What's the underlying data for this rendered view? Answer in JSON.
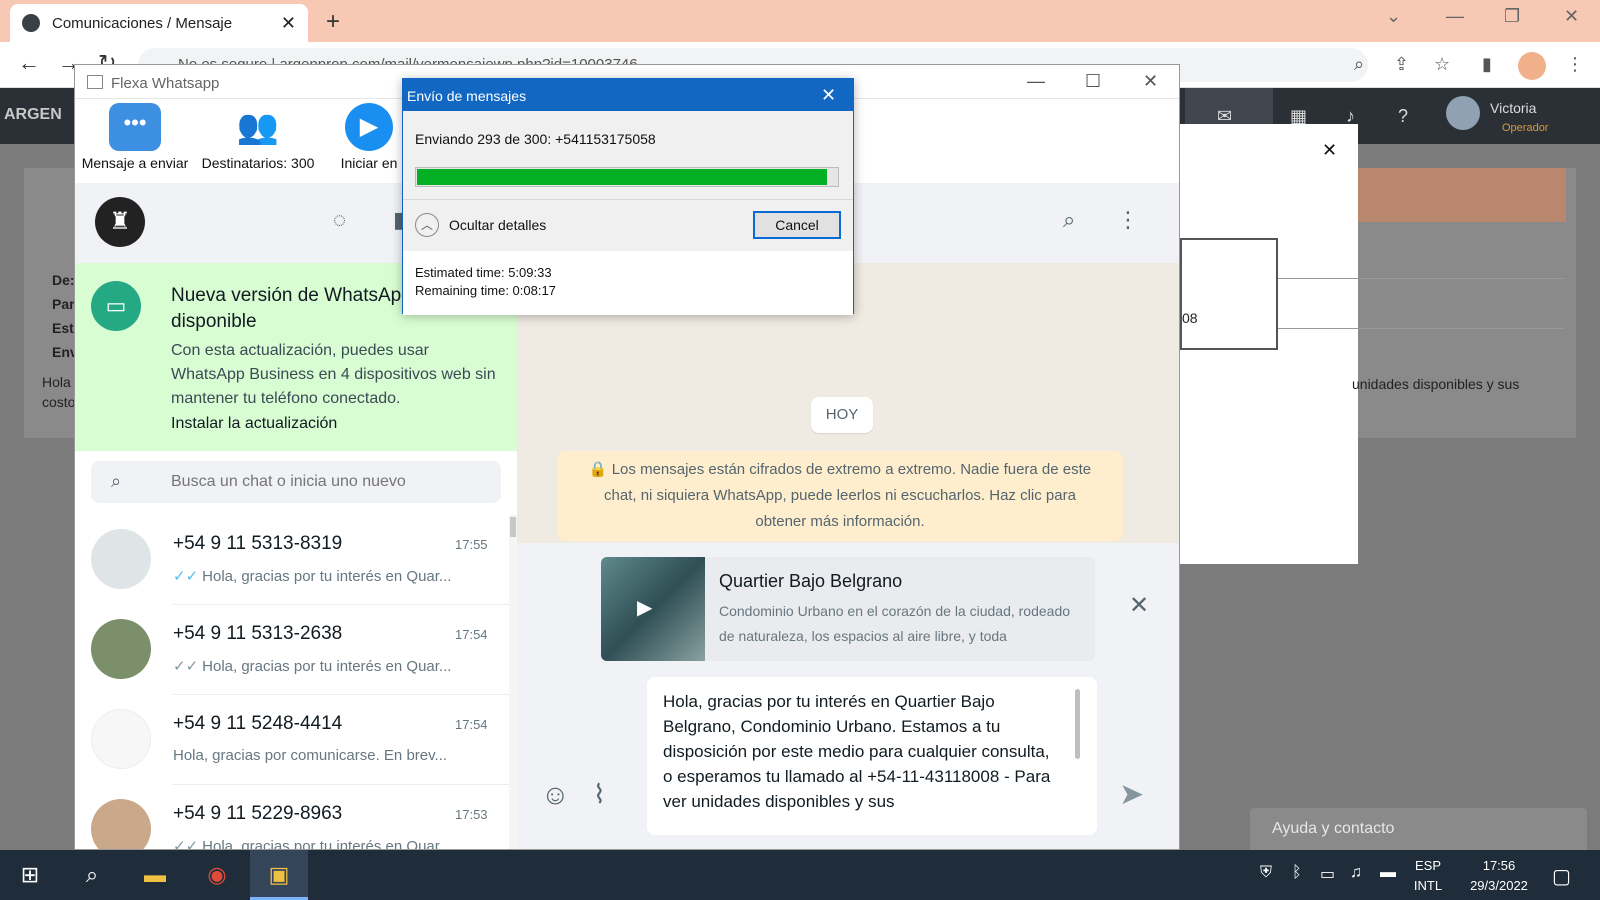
{
  "browser": {
    "tab_title": "Comunicaciones / Mensaje",
    "address": "No es seguro | argenprop.com/mail/vermensajewp.php?id=10003746"
  },
  "page": {
    "logo": "ARGEN",
    "user_name": "Victoria",
    "user_role": "Operador",
    "labels": [
      "De:",
      "Par",
      "Est",
      "Env"
    ],
    "body_left": "Hola",
    "body_left2": "costo",
    "body_right": "unidades disponibles y sus",
    "boxed_text": "08",
    "help_button": "Ayuda y contacto"
  },
  "flexa": {
    "window_title": "Flexa Whatsapp",
    "toolbar": {
      "message_label": "Mensaje a enviar",
      "recipients_label": "Destinatarios: 300",
      "start_label": "Iniciar en"
    }
  },
  "whatsapp": {
    "update": {
      "title": "Nueva versión de WhatsApp disponible",
      "body": "Con esta actualización, puedes usar WhatsApp Business en 4 dispositivos web sin mantener tu teléfono conectado.",
      "link": "Instalar la actualización"
    },
    "search_placeholder": "Busca un chat o inicia uno nuevo",
    "chats": [
      {
        "name": "+54 9 11 5313-8319",
        "time": "17:55",
        "preview": "Hola, gracias por tu interés en Quar...",
        "ticks": "✓✓"
      },
      {
        "name": "+54 9 11 5313-2638",
        "time": "17:54",
        "preview": "Hola, gracias por tu interés en Quar...",
        "ticks": "✓✓"
      },
      {
        "name": "+54 9 11 5248-4414",
        "time": "17:54",
        "preview": "Hola, gracias por comunicarse. En brev...",
        "ticks": ""
      },
      {
        "name": "+54 9 11 5229-8963",
        "time": "17:53",
        "preview": "Hola, gracias por tu interés en Quar...",
        "ticks": "✓✓"
      }
    ],
    "day_label": "HOY",
    "encryption_notice": "Los mensajes están cifrados de extremo a extremo. Nadie fuera de este chat, ni siquiera WhatsApp, puede leerlos ni escucharlos. Haz clic para obtener más información.",
    "link_preview": {
      "title": "Quartier Bajo Belgrano",
      "description": "Condominio Urbano en el corazón de la ciudad, rodeado de naturaleza, los espacios al aire libre, y toda"
    },
    "compose_text": "Hola, gracias por tu interés en Quartier Bajo Belgrano, Condominio Urbano. Estamos a tu disposición por este medio para cualquier consulta, o esperamos tu llamado al +54-11-43118008  - Para ver unidades disponibles y sus"
  },
  "dialog": {
    "title": "Envío de mensajes",
    "status": "Enviando 293 de 300: +541153175058",
    "progress_fraction": 0.977,
    "toggle_label": "Ocultar detalles",
    "cancel_label": "Cancel",
    "estimated": "Estimated time: 5:09:33",
    "remaining": "Remaining time: 0:08:17"
  },
  "taskbar": {
    "lang1": "ESP",
    "lang2": "INTL",
    "time": "17:56",
    "date": "29/3/2022"
  },
  "colors": {
    "progress": "#06b025",
    "dialog_title": "#1167c2",
    "wa_green": "#25a884",
    "update_bg": "#d9fdd3"
  }
}
